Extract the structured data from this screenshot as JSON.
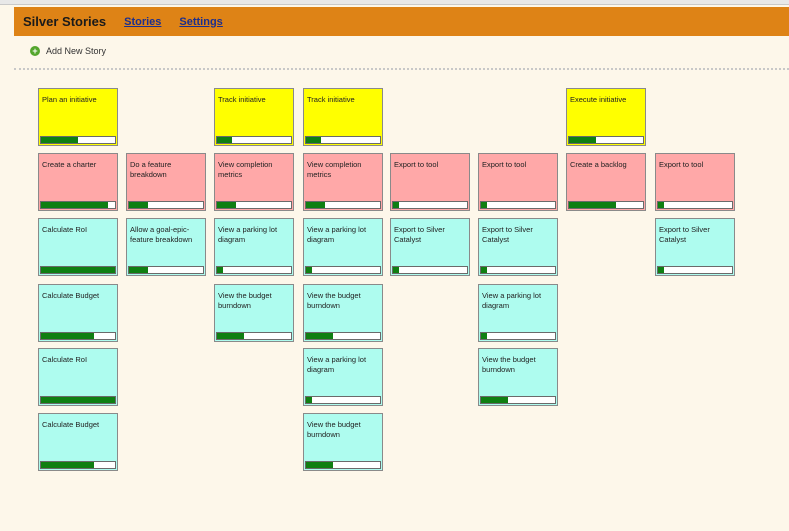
{
  "app": {
    "title": "Silver Stories",
    "nav": [
      "Stories",
      "Settings"
    ],
    "add_story_label": "Add New Story"
  },
  "colors": {
    "header": "#de8316",
    "initiative": "#ffff00",
    "feature": "#ffa8a8",
    "story": "#aefcef",
    "progress": "#0f7f12"
  },
  "cards": [
    {
      "title": "Plan an initiative",
      "kind": "initiative",
      "col": 0,
      "row": 0,
      "progress": 0.5
    },
    {
      "title": "Create a charter",
      "kind": "feature",
      "col": 0,
      "row": 1,
      "progress": 0.9
    },
    {
      "title": "Calculate RoI",
      "kind": "story",
      "col": 0,
      "row": 2,
      "progress": 1.0
    },
    {
      "title": "Calculate Budget",
      "kind": "story",
      "col": 0,
      "row": 3,
      "progress": 0.72
    },
    {
      "title": "Calculate RoI",
      "kind": "story",
      "col": 0,
      "row": 4,
      "progress": 1.0
    },
    {
      "title": "Calculate Budget",
      "kind": "story",
      "col": 0,
      "row": 5,
      "progress": 0.72
    },
    {
      "title": "Do a feature breakdown",
      "kind": "feature",
      "col": 1,
      "row": 1,
      "progress": 0.25
    },
    {
      "title": "Allow a goal-epic-feature breakdown",
      "kind": "story",
      "col": 1,
      "row": 2,
      "progress": 0.25
    },
    {
      "title": "Track initiative",
      "kind": "initiative",
      "col": 2,
      "row": 0,
      "progress": 0.2
    },
    {
      "title": "View completion metrics",
      "kind": "feature",
      "col": 2,
      "row": 1,
      "progress": 0.25
    },
    {
      "title": "View a parking lot diagram",
      "kind": "story",
      "col": 2,
      "row": 2,
      "progress": 0.08
    },
    {
      "title": "View the budget burndown",
      "kind": "story",
      "col": 2,
      "row": 3,
      "progress": 0.36
    },
    {
      "title": "Track initiative",
      "kind": "initiative",
      "col": 3,
      "row": 0,
      "progress": 0.2
    },
    {
      "title": "View completion metrics",
      "kind": "feature",
      "col": 3,
      "row": 1,
      "progress": 0.25
    },
    {
      "title": "View a parking lot diagram",
      "kind": "story",
      "col": 3,
      "row": 2,
      "progress": 0.08
    },
    {
      "title": "View the budget burndown",
      "kind": "story",
      "col": 3,
      "row": 3,
      "progress": 0.36
    },
    {
      "title": "View a parking lot diagram",
      "kind": "story",
      "col": 3,
      "row": 4,
      "progress": 0.08
    },
    {
      "title": "View the budget burndown",
      "kind": "story",
      "col": 3,
      "row": 5,
      "progress": 0.36
    },
    {
      "title": "Export to tool",
      "kind": "feature",
      "col": 4,
      "row": 1,
      "progress": 0.08
    },
    {
      "title": "Export to Silver Catalyst",
      "kind": "story",
      "col": 4,
      "row": 2,
      "progress": 0.08
    },
    {
      "title": "Export to tool",
      "kind": "feature",
      "col": 5,
      "row": 1,
      "progress": 0.08
    },
    {
      "title": "Export to Silver Catalyst",
      "kind": "story",
      "col": 5,
      "row": 2,
      "progress": 0.08
    },
    {
      "title": "View a parking lot diagram",
      "kind": "story",
      "col": 5,
      "row": 3,
      "progress": 0.08
    },
    {
      "title": "View the budget burndown",
      "kind": "story",
      "col": 5,
      "row": 4,
      "progress": 0.36
    },
    {
      "title": "Execute initiative",
      "kind": "initiative",
      "col": 6,
      "row": 0,
      "progress": 0.36
    },
    {
      "title": "Create a backlog",
      "kind": "feature",
      "col": 6,
      "row": 1,
      "progress": 0.64
    },
    {
      "title": "Export to tool",
      "kind": "feature",
      "col": 7,
      "row": 1,
      "progress": 0.08
    },
    {
      "title": "Export to Silver Catalyst",
      "kind": "story",
      "col": 7,
      "row": 2,
      "progress": 0.08
    }
  ]
}
